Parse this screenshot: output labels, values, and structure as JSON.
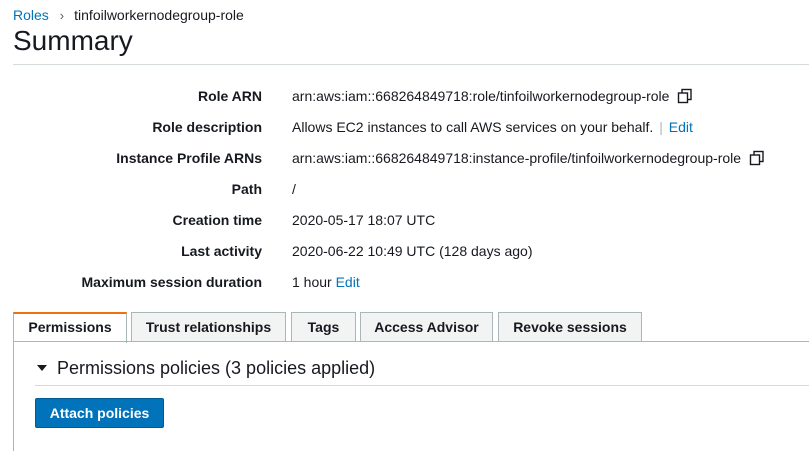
{
  "breadcrumb": {
    "parent": "Roles",
    "separator": "›",
    "current": "tinfoilworkernodegroup-role"
  },
  "page_title": "Summary",
  "summary": {
    "role_arn": {
      "label": "Role ARN",
      "value": "arn:aws:iam::668264849718:role/tinfoilworkernodegroup-role"
    },
    "role_description": {
      "label": "Role description",
      "value": "Allows EC2 instances to call AWS services on your behalf.",
      "separator": "|",
      "edit": "Edit"
    },
    "instance_profile_arns": {
      "label": "Instance Profile ARNs",
      "value": "arn:aws:iam::668264849718:instance-profile/tinfoilworkernodegroup-role"
    },
    "path": {
      "label": "Path",
      "value": "/"
    },
    "creation_time": {
      "label": "Creation time",
      "value": "2020-05-17 18:07 UTC"
    },
    "last_activity": {
      "label": "Last activity",
      "value": "2020-06-22 10:49 UTC (128 days ago)"
    },
    "max_session": {
      "label": "Maximum session duration",
      "value": "1 hour",
      "edit": "Edit"
    }
  },
  "tabs": [
    {
      "label": "Permissions",
      "active": true
    },
    {
      "label": "Trust relationships",
      "active": false
    },
    {
      "label": "Tags",
      "active": false
    },
    {
      "label": "Access Advisor",
      "active": false
    },
    {
      "label": "Revoke sessions",
      "active": false
    }
  ],
  "permissions": {
    "header": "Permissions policies (3 policies applied)",
    "attach_button": "Attach policies"
  },
  "colors": {
    "link": "#0073bb",
    "active_tab_accent": "#ec7211",
    "primary_button": "#0073bb"
  },
  "icons": {
    "copy": "copy-icon",
    "expand": "caret-down-icon",
    "breadcrumb_separator": "chevron-right-icon"
  }
}
